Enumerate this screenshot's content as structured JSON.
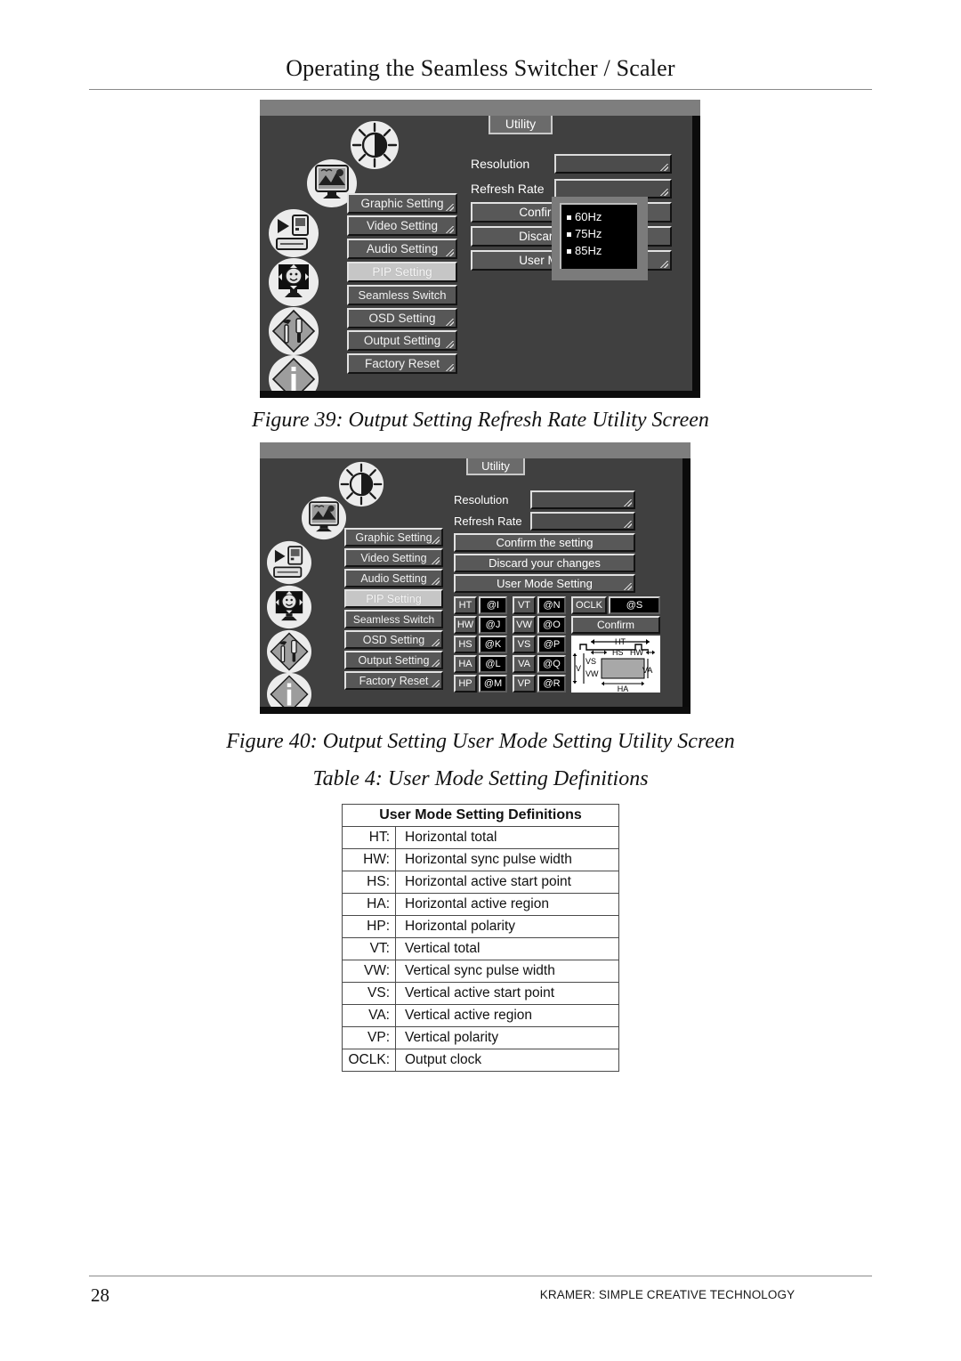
{
  "header": {
    "title": "Operating the Seamless Switcher / Scaler"
  },
  "figure39": {
    "caption": "Figure 39: Output Setting Refresh Rate Utility Screen",
    "tab_label": "Utility",
    "menu_items": [
      {
        "label": "Graphic Setting",
        "active": false
      },
      {
        "label": "Video Setting",
        "active": false
      },
      {
        "label": "Audio Setting",
        "active": false
      },
      {
        "label": "PIP Setting",
        "active": true
      },
      {
        "label": "Seamless Switch",
        "active": false
      },
      {
        "label": "OSD Setting",
        "active": false
      },
      {
        "label": "Output Setting",
        "active": false
      },
      {
        "label": "Factory Reset",
        "active": false
      }
    ],
    "fields": [
      {
        "label": "Resolution",
        "value": ""
      },
      {
        "label": "Refresh Rate",
        "value": ""
      }
    ],
    "actions": [
      {
        "label": "Confirm the setting"
      },
      {
        "label": "Discard your changes"
      },
      {
        "label": "User Mode Setting"
      }
    ],
    "action_visible_text": [
      "Confirm",
      "Discard",
      "User M"
    ],
    "dropdown": {
      "options": [
        "60Hz",
        "75Hz",
        "85Hz"
      ]
    }
  },
  "figure40": {
    "caption": "Figure 40: Output Setting User Mode Setting Utility Screen",
    "tab_label": "Utility",
    "menu_items": [
      {
        "label": "Graphic Setting",
        "active": false
      },
      {
        "label": "Video Setting",
        "active": false
      },
      {
        "label": "Audio Setting",
        "active": false
      },
      {
        "label": "PIP Setting",
        "active": true
      },
      {
        "label": "Seamless Switch",
        "active": false
      },
      {
        "label": "OSD Setting",
        "active": false
      },
      {
        "label": "Output Setting",
        "active": false
      },
      {
        "label": "Factory Reset",
        "active": false
      }
    ],
    "fields": [
      {
        "label": "Resolution",
        "value": ""
      },
      {
        "label": "Refresh Rate",
        "value": ""
      }
    ],
    "actions": [
      {
        "label": "Confirm the setting"
      },
      {
        "label": "Discard your changes"
      },
      {
        "label": "User Mode Setting"
      }
    ],
    "param_grid": {
      "column1": [
        {
          "key": "HT",
          "value": "@I"
        },
        {
          "key": "HW",
          "value": "@J"
        },
        {
          "key": "HS",
          "value": "@K"
        },
        {
          "key": "HA",
          "value": "@L"
        },
        {
          "key": "HP",
          "value": "@M"
        }
      ],
      "column2": [
        {
          "key": "VT",
          "value": "@N"
        },
        {
          "key": "VW",
          "value": "@O"
        },
        {
          "key": "VS",
          "value": "@P"
        },
        {
          "key": "VA",
          "value": "@Q"
        },
        {
          "key": "VP",
          "value": "@R"
        }
      ],
      "column3": {
        "key": "OCLK",
        "value": "@S",
        "confirm_label": "Confirm"
      }
    },
    "timing_diagram": {
      "labels": [
        "HT",
        "HS",
        "HW",
        "VS",
        "VW",
        "VA",
        "HA",
        "V"
      ]
    }
  },
  "table4": {
    "caption": "Table 4: User Mode Setting Definitions",
    "header": "User Mode Setting Definitions",
    "rows": [
      {
        "abbr": "HT:",
        "desc": "Horizontal total"
      },
      {
        "abbr": "HW:",
        "desc": "Horizontal sync pulse width"
      },
      {
        "abbr": "HS:",
        "desc": "Horizontal active start point"
      },
      {
        "abbr": "HA:",
        "desc": "Horizontal active region"
      },
      {
        "abbr": "HP:",
        "desc": "Horizontal polarity"
      },
      {
        "abbr": "VT:",
        "desc": "Vertical total"
      },
      {
        "abbr": "VW:",
        "desc": "Vertical sync pulse width"
      },
      {
        "abbr": "VS:",
        "desc": "Vertical active start point"
      },
      {
        "abbr": "VA:",
        "desc": "Vertical active region"
      },
      {
        "abbr": "VP:",
        "desc": "Vertical polarity"
      },
      {
        "abbr": "OCLK:",
        "desc": "Output clock"
      }
    ]
  },
  "footer": {
    "page_number": "28",
    "brand": "KRAMER:  SIMPLE CREATIVE TECHNOLOGY"
  },
  "colors": {
    "panel_body": "#404040",
    "panel_titlebar": "#7e7e7e",
    "button_face": "#575757",
    "button_active": "#c6c6c6",
    "dropdown_bg": "#000000",
    "text_light": "#ffffff",
    "text_dark": "#111111"
  }
}
